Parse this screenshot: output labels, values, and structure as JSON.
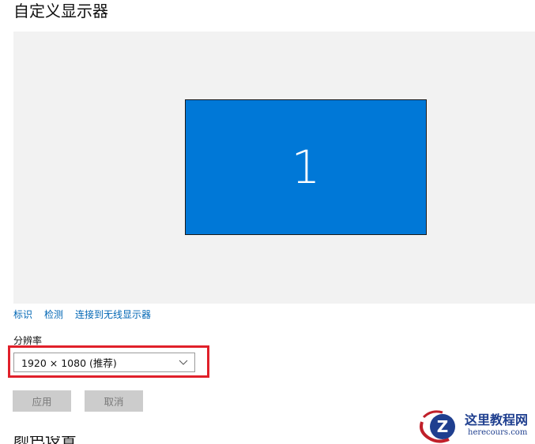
{
  "page": {
    "title": "自定义显示器",
    "next_section_title": "颜色设置"
  },
  "display_area": {
    "monitor_number": "1",
    "monitor_color": "#0078d7",
    "background_color": "#f2f2f2"
  },
  "links": {
    "identify": "标识",
    "detect": "检测",
    "connect_wireless": "连接到无线显示器"
  },
  "resolution": {
    "label": "分辨率",
    "selected": "1920 × 1080 (推荐)",
    "highlight_color": "#e0202a"
  },
  "buttons": {
    "apply": "应用",
    "cancel": "取消"
  },
  "watermark": {
    "title": "这里教程网",
    "url": "herecours.com",
    "icon": "z-logo-icon"
  }
}
